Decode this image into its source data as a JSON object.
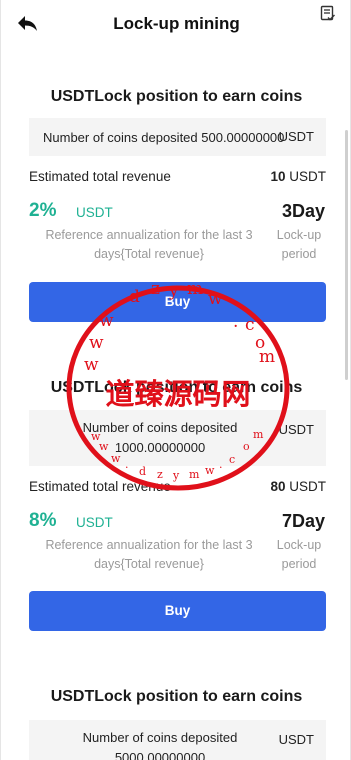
{
  "header": {
    "title": "Lock-up mining"
  },
  "cards": [
    {
      "title": "USDTLock position to earn coins",
      "deposit_text": "Number of coins deposited 500.00000000",
      "deposit_unit": "USDT",
      "revenue_label": "Estimated total revenue",
      "revenue_value": "10",
      "revenue_unit": "USDT",
      "rate": "2%",
      "rate_unit": "USDT",
      "days": "3Day",
      "reference_note": "Reference annualization for the last 3 days{Total revenue}",
      "period_note": "Lock-up period",
      "buy_label": "Buy"
    },
    {
      "title": "USDTLock position to earn coins",
      "deposit_line1": "Number of coins deposited",
      "deposit_line2": "1000.00000000",
      "deposit_unit": "USDT",
      "revenue_label": "Estimated total revenue",
      "revenue_value": "80",
      "revenue_unit": "USDT",
      "rate": "8%",
      "rate_unit": "USDT",
      "days": "7Day",
      "reference_note": "Reference annualization for the last 3 days{Total revenue}",
      "period_note": "Lock-up period",
      "buy_label": "Buy"
    },
    {
      "title": "USDTLock position to earn coins",
      "deposit_line1": "Number of coins deposited",
      "deposit_line2": "5000.00000000",
      "deposit_unit": "USDT"
    }
  ],
  "watermark": {
    "text_cn": "道臻源码网",
    "domain_text": "www.dzymw.com"
  },
  "colors": {
    "accent_green": "#1fb193",
    "button_blue": "#3366e6",
    "watermark_red": "#e0101a"
  }
}
